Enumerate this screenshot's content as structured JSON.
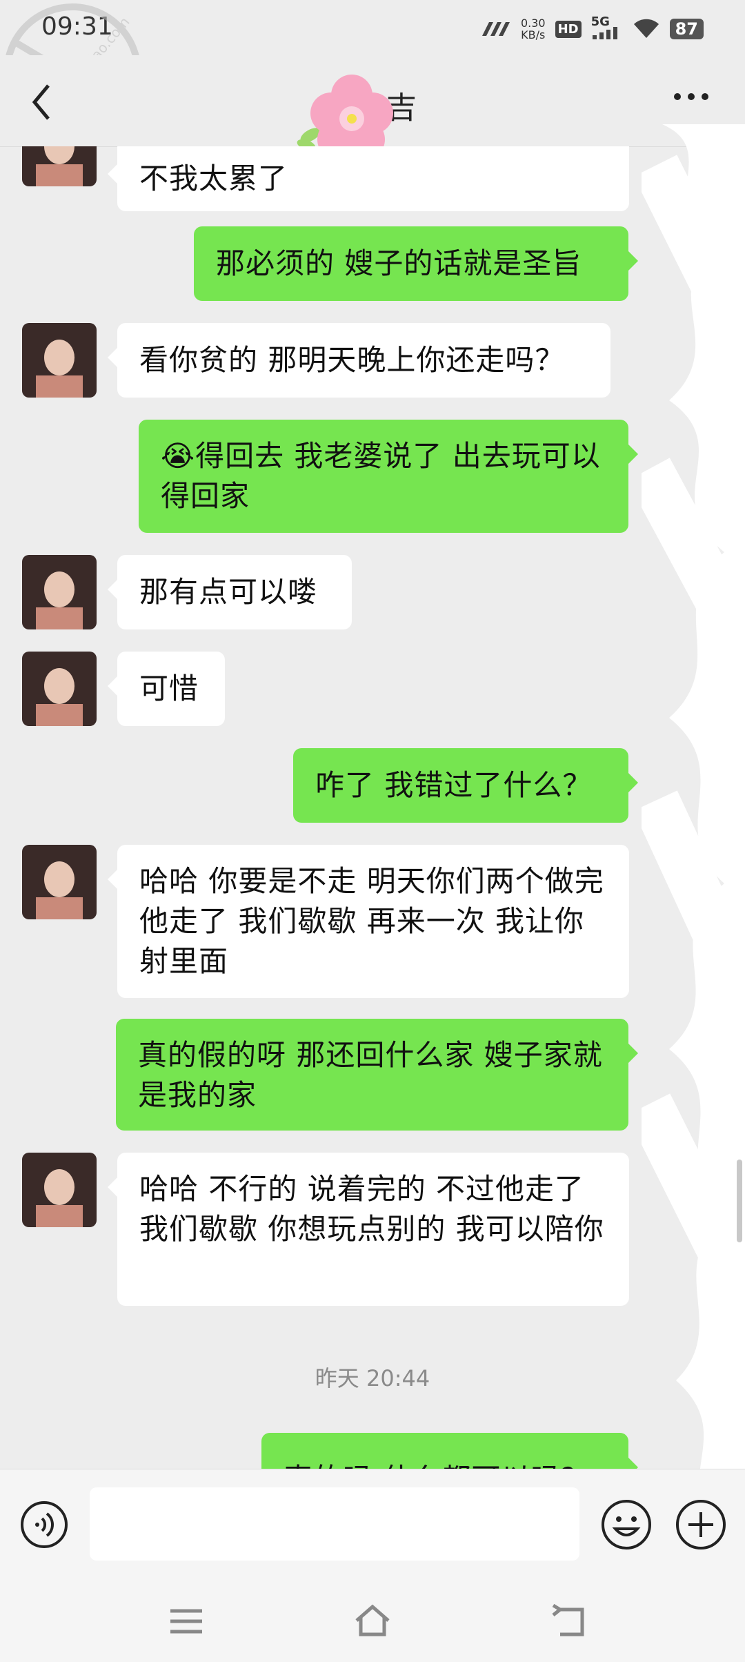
{
  "status_bar": {
    "time": "09:31",
    "net_speed_value": "0.30",
    "net_speed_unit": "KB/s",
    "hd": "HD",
    "network": "5G",
    "battery": "87"
  },
  "header": {
    "title": "吉",
    "watermark": "haijiao.com 海角社区"
  },
  "messages": [
    {
      "side": "in",
      "text": "不我太累了"
    },
    {
      "side": "out",
      "text": "那必须的 嫂子的话就是圣旨"
    },
    {
      "side": "in",
      "text": "看你贫的  那明天晚上你还走吗？"
    },
    {
      "side": "out",
      "emoji": "😭",
      "text": "得回去  我老婆说了 出去玩可以  得回家"
    },
    {
      "side": "in",
      "text": "那有点可以喽"
    },
    {
      "side": "in",
      "text": "可惜"
    },
    {
      "side": "out",
      "text": "咋了  我错过了什么？"
    },
    {
      "side": "in",
      "text": "哈哈  你要是不走  明天你们两个做完 他走了  我们歇歇  再来一次  我让你射里面"
    },
    {
      "side": "out",
      "text": "真的假的呀  那还回什么家  嫂子家就是我的家"
    },
    {
      "side": "in",
      "text": "哈哈   不行的   说着完的 不过他走了  我们歇歇  你想玩点别的  我可以陪你"
    },
    {
      "side": "out",
      "text": "真的吗  什么都可以吗？"
    }
  ],
  "timestamp": "昨天 20:44",
  "colors": {
    "background": "#ededed",
    "incoming_bubble": "#ffffff",
    "outgoing_bubble": "#76e550",
    "timestamp_text": "#8a8a8a"
  },
  "icons": {
    "back": "chevron-left-icon",
    "more": "more-dots-icon",
    "voice": "voice-icon",
    "emoji": "emoji-icon",
    "plus": "plus-icon",
    "menu": "menu-icon",
    "home": "home-icon",
    "back_nav": "back-icon"
  }
}
